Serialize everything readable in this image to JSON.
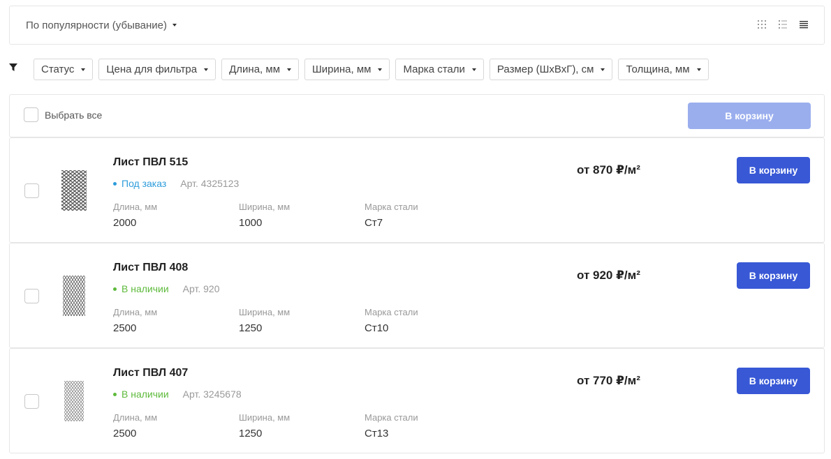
{
  "sort": {
    "label": "По популярности (убывание)"
  },
  "view_modes": [
    {
      "icon": "grid-view-icon"
    },
    {
      "icon": "list-view-icon"
    },
    {
      "icon": "table-view-icon"
    }
  ],
  "filters": [
    {
      "label": "Статус"
    },
    {
      "label": "Цена для фильтра"
    },
    {
      "label": "Длина, мм"
    },
    {
      "label": "Ширина, мм"
    },
    {
      "label": "Марка стали"
    },
    {
      "label": "Размер (ШхВхГ), см"
    },
    {
      "label": "Толщина, мм"
    }
  ],
  "select_bar": {
    "select_all_label": "Выбрать все",
    "cart_button": "В корзину"
  },
  "colors": {
    "accent": "#3858d6",
    "accent_disabled": "#9aaeee",
    "status_order": "#2d9cdb",
    "status_in_stock": "#5dba3b"
  },
  "products": [
    {
      "title": "Лист ПВЛ 515",
      "status": "Под заказ",
      "status_color": "#2d9cdb",
      "article": "Арт. 4325123",
      "props": [
        {
          "label": "Длина, мм",
          "value": "2000"
        },
        {
          "label": "Ширина, мм",
          "value": "1000"
        },
        {
          "label": "Марка стали",
          "value": "Ст7"
        }
      ],
      "price": "от 870 ₽/м²",
      "cart_button": "В корзину"
    },
    {
      "title": "Лист ПВЛ 408",
      "status": "В наличии",
      "status_color": "#5dba3b",
      "article": "Арт. 920",
      "props": [
        {
          "label": "Длина, мм",
          "value": "2500"
        },
        {
          "label": "Ширина, мм",
          "value": "1250"
        },
        {
          "label": "Марка стали",
          "value": "Ст10"
        }
      ],
      "price": "от 920 ₽/м²",
      "cart_button": "В корзину"
    },
    {
      "title": "Лист ПВЛ 407",
      "status": "В наличии",
      "status_color": "#5dba3b",
      "article": "Арт. 3245678",
      "props": [
        {
          "label": "Длина, мм",
          "value": "2500"
        },
        {
          "label": "Ширина, мм",
          "value": "1250"
        },
        {
          "label": "Марка стали",
          "value": "Ст13"
        }
      ],
      "price": "от 770 ₽/м²",
      "cart_button": "В корзину"
    }
  ]
}
